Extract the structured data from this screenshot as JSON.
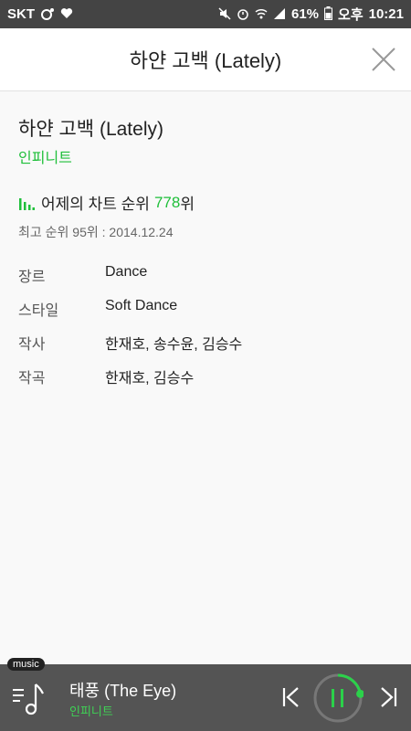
{
  "status_bar": {
    "carrier": "SKT",
    "battery_percent": "61%",
    "ampm": "오후",
    "time": "10:21"
  },
  "header": {
    "title": "하얀 고백 (Lately)"
  },
  "song": {
    "title": "하얀 고백 (Lately)",
    "artist": "인피니트",
    "chart_prefix": "어제의 차트 순위",
    "chart_rank": "778",
    "chart_unit": "위",
    "best_rank": "최고 순위 95위 : 2014.12.24"
  },
  "info": [
    {
      "label": "장르",
      "value": "Dance"
    },
    {
      "label": "스타일",
      "value": "Soft Dance"
    },
    {
      "label": "작사",
      "value": "한재호, 송수윤, 김승수"
    },
    {
      "label": "작곡",
      "value": "한재호, 김승수"
    }
  ],
  "player": {
    "badge": "music",
    "title": "태풍 (The Eye)",
    "artist": "인피니트",
    "progress": 0.22
  },
  "colors": {
    "accent": "#1fbf3a",
    "status_bar": "#444444",
    "player_bg": "#545454"
  }
}
